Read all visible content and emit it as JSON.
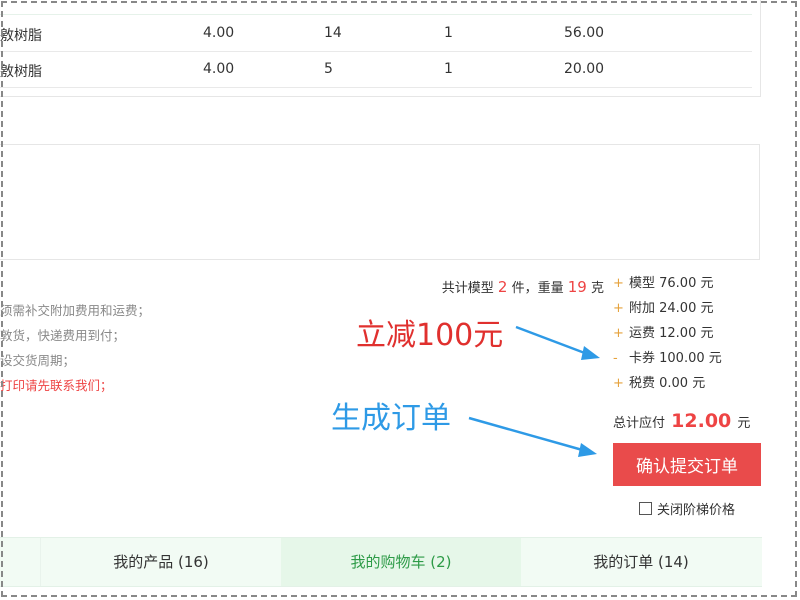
{
  "table": {
    "rows": [
      {
        "name": "敫树脂",
        "price": "4.00",
        "qty": "14",
        "count": "1",
        "subtotal": "56.00"
      },
      {
        "name": "敫树脂",
        "price": "4.00",
        "qty": "5",
        "count": "1",
        "subtotal": "20.00"
      }
    ]
  },
  "summary": {
    "prefix": "共计模型",
    "count": "2",
    "count_unit": "件，重量",
    "weight": "19",
    "weight_unit": "克"
  },
  "fees": [
    {
      "sign": "+",
      "label": "模型 76.00 元"
    },
    {
      "sign": "+",
      "label": "附加 24.00 元"
    },
    {
      "sign": "+",
      "label": "运费 12.00 元"
    },
    {
      "sign": "-",
      "label": "卡券 100.00 元"
    },
    {
      "sign": "+",
      "label": "税费 0.00 元"
    }
  ],
  "notes": [
    "须需补交附加费用和运费；",
    "敦货，快递费用到付；",
    "设交货周期；",
    "打印请先联系我们；"
  ],
  "annotations": {
    "discount": "立减100元",
    "generate_order": "生成订单"
  },
  "total": {
    "label": "总计应付",
    "amount": "12.00",
    "unit": "元"
  },
  "submit_label": "确认提交订单",
  "tier_checkbox_label": "关闭阶梯价格",
  "tabs": [
    {
      "label": "我的产品 (16)",
      "active": false
    },
    {
      "label": "我的购物车 (2)",
      "active": true
    },
    {
      "label": "我的订单 (14)",
      "active": false
    }
  ],
  "colors": {
    "accent_red": "#e94b4b",
    "annotation_red": "#e0302e",
    "annotation_blue": "#2e9ae6",
    "tab_active_green": "#2d9b47"
  }
}
